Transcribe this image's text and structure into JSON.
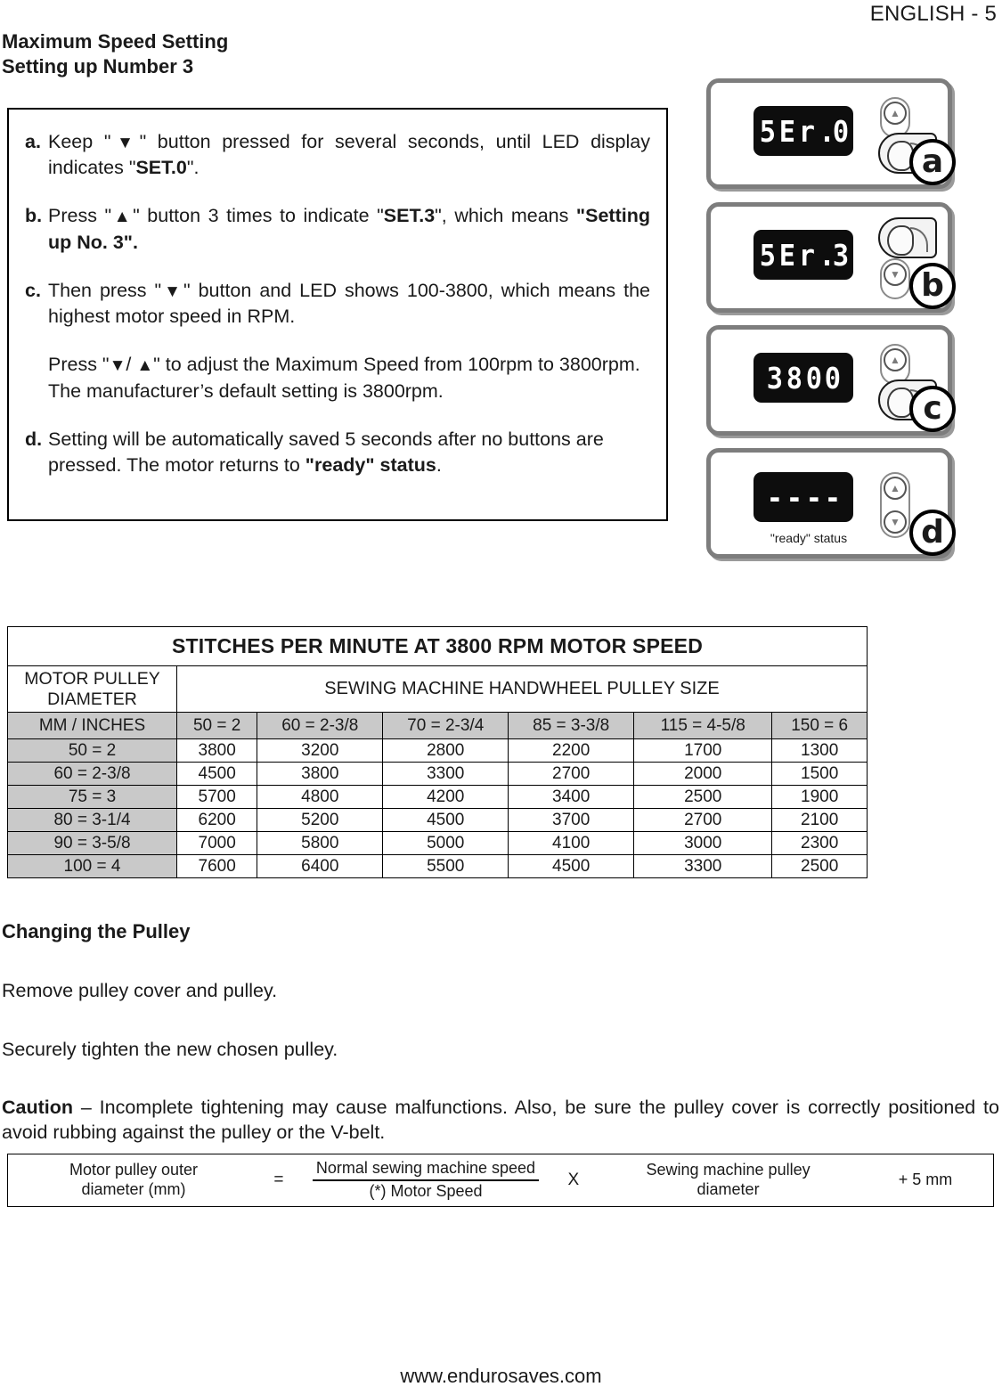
{
  "header": {
    "page_label": "ENGLISH - 5"
  },
  "title": {
    "line1": "Maximum Speed Setting",
    "line2": "Setting up Number 3"
  },
  "instructions": [
    {
      "marker": "a.",
      "parts": [
        {
          "text": "Keep \"",
          "bold": false
        },
        {
          "text": "▼",
          "bold": false,
          "arrow": true
        },
        {
          "text": "\" button pressed for several seconds, until LED display indicates \"",
          "bold": false
        },
        {
          "text": "SET.0",
          "bold": true
        },
        {
          "text": "\".",
          "bold": false
        }
      ]
    },
    {
      "marker": "b.",
      "parts": [
        {
          "text": "Press \"",
          "bold": false
        },
        {
          "text": "▲",
          "bold": false,
          "arrow": true
        },
        {
          "text": "\" button 3 times to indicate \"",
          "bold": false
        },
        {
          "text": "SET.3",
          "bold": true
        },
        {
          "text": "\", which means ",
          "bold": false
        },
        {
          "text": "\"Setting up No. 3\".",
          "bold": true
        }
      ]
    },
    {
      "marker": "c.",
      "parts": [
        {
          "text": "Then press \"",
          "bold": false
        },
        {
          "text": "▼",
          "bold": false,
          "arrow": true
        },
        {
          "text": "\" button and LED shows 100-3800, which means the highest motor speed in RPM.",
          "bold": false
        }
      ]
    },
    {
      "marker": "",
      "parts": [
        {
          "text": "Press \"",
          "bold": false
        },
        {
          "text": "▼",
          "bold": false,
          "arrow": true
        },
        {
          "text": "/ ",
          "bold": false
        },
        {
          "text": "▲",
          "bold": false,
          "arrow": true
        },
        {
          "text": "\" to adjust the Maximum Speed from 100rpm to 3800rpm. The manufacturer’s default setting is 3800rpm.",
          "bold": false
        }
      ]
    },
    {
      "marker": "d.",
      "parts": [
        {
          "text": "Setting will be automatically saved 5 seconds after no buttons are pressed. The motor returns to ",
          "bold": false
        },
        {
          "text": "\"ready\" status",
          "bold": true
        },
        {
          "text": ".",
          "bold": false
        }
      ]
    }
  ],
  "panels": [
    {
      "letter": "a",
      "display": "SEr.0",
      "digits": [
        "5",
        "E",
        "r",
        ".0"
      ],
      "buttons": [
        "▲"
      ],
      "finger": true,
      "caption": ""
    },
    {
      "letter": "b",
      "display": "SEr.3",
      "digits": [
        "5",
        "E",
        "r",
        ".3"
      ],
      "buttons": [
        "▼"
      ],
      "finger": true,
      "caption": ""
    },
    {
      "letter": "c",
      "display": "3800",
      "digits": [
        "3",
        "8",
        "0",
        "0"
      ],
      "buttons": [
        "▲"
      ],
      "finger": true,
      "caption": ""
    },
    {
      "letter": "d",
      "display": "- - - -",
      "digits": [
        "-",
        "-",
        "-",
        "-"
      ],
      "buttons": [
        "▲",
        "▼"
      ],
      "finger": false,
      "caption": "\"ready\" status"
    }
  ],
  "spm_table": {
    "title": "STITCHES PER MINUTE AT 3800 RPM MOTOR SPEED",
    "row_header_title": "MOTOR  PULLEY DIAMETER",
    "col_group_title": "SEWING MACHINE HANDWHEEL PULLEY SIZE",
    "unit_header": "MM / INCHES",
    "columns": [
      "50 = 2",
      "60 = 2-3/8",
      "70 = 2-3/4",
      "85 = 3-3/8",
      "115 = 4-5/8",
      "150 = 6"
    ],
    "rows": [
      {
        "label": "50 = 2",
        "values": [
          "3800",
          "3200",
          "2800",
          "2200",
          "1700",
          "1300"
        ]
      },
      {
        "label": "60 = 2-3/8",
        "values": [
          "4500",
          "3800",
          "3300",
          "2700",
          "2000",
          "1500"
        ]
      },
      {
        "label": "75 = 3",
        "values": [
          "5700",
          "4800",
          "4200",
          "3400",
          "2500",
          "1900"
        ]
      },
      {
        "label": "80 = 3-1/4",
        "values": [
          "6200",
          "5200",
          "4500",
          "3700",
          "2700",
          "2100"
        ]
      },
      {
        "label": "90 = 3-5/8",
        "values": [
          "7000",
          "5800",
          "5000",
          "4100",
          "3000",
          "2300"
        ]
      },
      {
        "label": "100 = 4",
        "values": [
          "7600",
          "6400",
          "5500",
          "4500",
          "3300",
          "2500"
        ]
      }
    ]
  },
  "pulley": {
    "heading": "Changing the Pulley",
    "para1": "Remove pulley cover and pulley.",
    "para2": "Securely tighten the new chosen pulley.",
    "caution_label": "Caution",
    "caution_text": " – Incomplete tightening may cause malfunctions. Also, be sure the pulley cover is correctly positioned to avoid rubbing against the pulley or the V-belt."
  },
  "formula": {
    "result_line1": "Motor pulley outer",
    "result_line2": "diameter (mm)",
    "equals": "=",
    "numerator": "Normal sewing machine speed",
    "denominator": "(*) Motor Speed",
    "times": "X",
    "factor_line1": "Sewing machine pulley",
    "factor_line2": "diameter",
    "addend": "+ 5 mm"
  },
  "footer": {
    "website": "www.endurosaves.com"
  }
}
